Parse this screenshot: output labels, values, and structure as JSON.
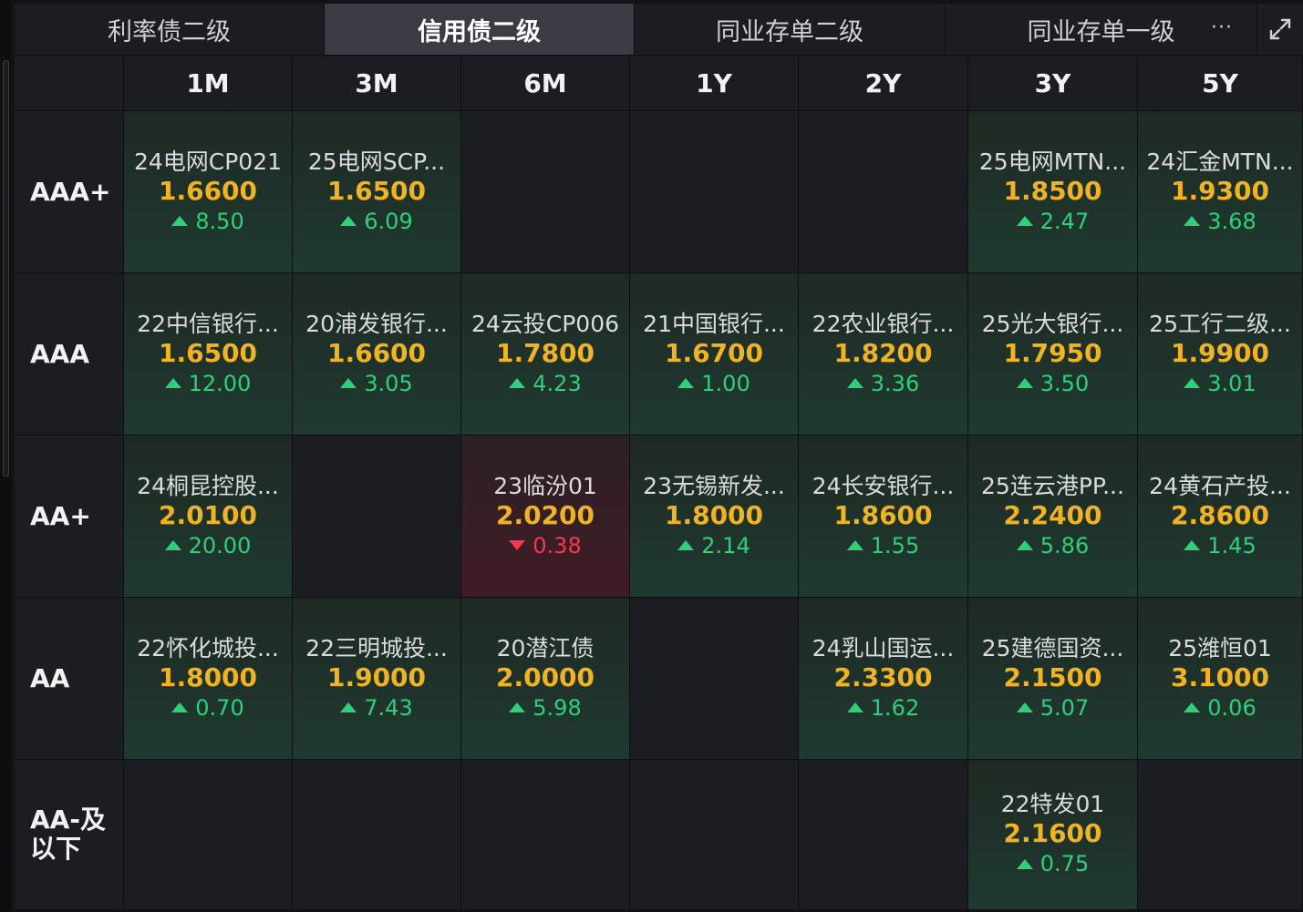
{
  "tabs": [
    {
      "label": "利率债二级",
      "active": false
    },
    {
      "label": "信用债二级",
      "active": true
    },
    {
      "label": "同业存单二级",
      "active": false
    },
    {
      "label": "同业存单一级",
      "active": false
    }
  ],
  "more_label": "···",
  "columns": [
    "1M",
    "3M",
    "6M",
    "1Y",
    "2Y",
    "3Y",
    "5Y"
  ],
  "rows": [
    {
      "label": "AAA+",
      "cells": [
        {
          "name": "24电网CP021",
          "yield": "1.6600",
          "change": "8.50",
          "dir": "up"
        },
        {
          "name": "25电网SCP...",
          "yield": "1.6500",
          "change": "6.09",
          "dir": "up"
        },
        null,
        null,
        null,
        {
          "name": "25电网MTN...",
          "yield": "1.8500",
          "change": "2.47",
          "dir": "up"
        },
        {
          "name": "24汇金MTN...",
          "yield": "1.9300",
          "change": "3.68",
          "dir": "up"
        }
      ]
    },
    {
      "label": "AAA",
      "cells": [
        {
          "name": "22中信银行...",
          "yield": "1.6500",
          "change": "12.00",
          "dir": "up"
        },
        {
          "name": "20浦发银行...",
          "yield": "1.6600",
          "change": "3.05",
          "dir": "up"
        },
        {
          "name": "24云投CP006",
          "yield": "1.7800",
          "change": "4.23",
          "dir": "up"
        },
        {
          "name": "21中国银行...",
          "yield": "1.6700",
          "change": "1.00",
          "dir": "up"
        },
        {
          "name": "22农业银行...",
          "yield": "1.8200",
          "change": "3.36",
          "dir": "up"
        },
        {
          "name": "25光大银行...",
          "yield": "1.7950",
          "change": "3.50",
          "dir": "up"
        },
        {
          "name": "25工行二级...",
          "yield": "1.9900",
          "change": "3.01",
          "dir": "up"
        }
      ]
    },
    {
      "label": "AA+",
      "cells": [
        {
          "name": "24桐昆控股...",
          "yield": "2.0100",
          "change": "20.00",
          "dir": "up"
        },
        null,
        {
          "name": "23临汾01",
          "yield": "2.0200",
          "change": "0.38",
          "dir": "down"
        },
        {
          "name": "23无锡新发...",
          "yield": "1.8000",
          "change": "2.14",
          "dir": "up"
        },
        {
          "name": "24长安银行...",
          "yield": "1.8600",
          "change": "1.55",
          "dir": "up"
        },
        {
          "name": "25连云港PP...",
          "yield": "2.2400",
          "change": "5.86",
          "dir": "up"
        },
        {
          "name": "24黄石产投...",
          "yield": "2.8600",
          "change": "1.45",
          "dir": "up"
        }
      ]
    },
    {
      "label": "AA",
      "cells": [
        {
          "name": "22怀化城投...",
          "yield": "1.8000",
          "change": "0.70",
          "dir": "up"
        },
        {
          "name": "22三明城投...",
          "yield": "1.9000",
          "change": "7.43",
          "dir": "up"
        },
        {
          "name": "20潜江债",
          "yield": "2.0000",
          "change": "5.98",
          "dir": "up"
        },
        null,
        {
          "name": "24乳山国运...",
          "yield": "2.3300",
          "change": "1.62",
          "dir": "up"
        },
        {
          "name": "25建德国资...",
          "yield": "2.1500",
          "change": "5.07",
          "dir": "up"
        },
        {
          "name": "25潍恒01",
          "yield": "3.1000",
          "change": "0.06",
          "dir": "up"
        }
      ]
    },
    {
      "label": "AA-及以下",
      "cells": [
        null,
        null,
        null,
        null,
        null,
        {
          "name": "22特发01",
          "yield": "2.1600",
          "change": "0.75",
          "dir": "up"
        },
        null
      ]
    }
  ],
  "colors": {
    "yield": "#f0b323",
    "up": "#2ed07a",
    "down": "#f2394f",
    "bg": "#1c1d22"
  }
}
